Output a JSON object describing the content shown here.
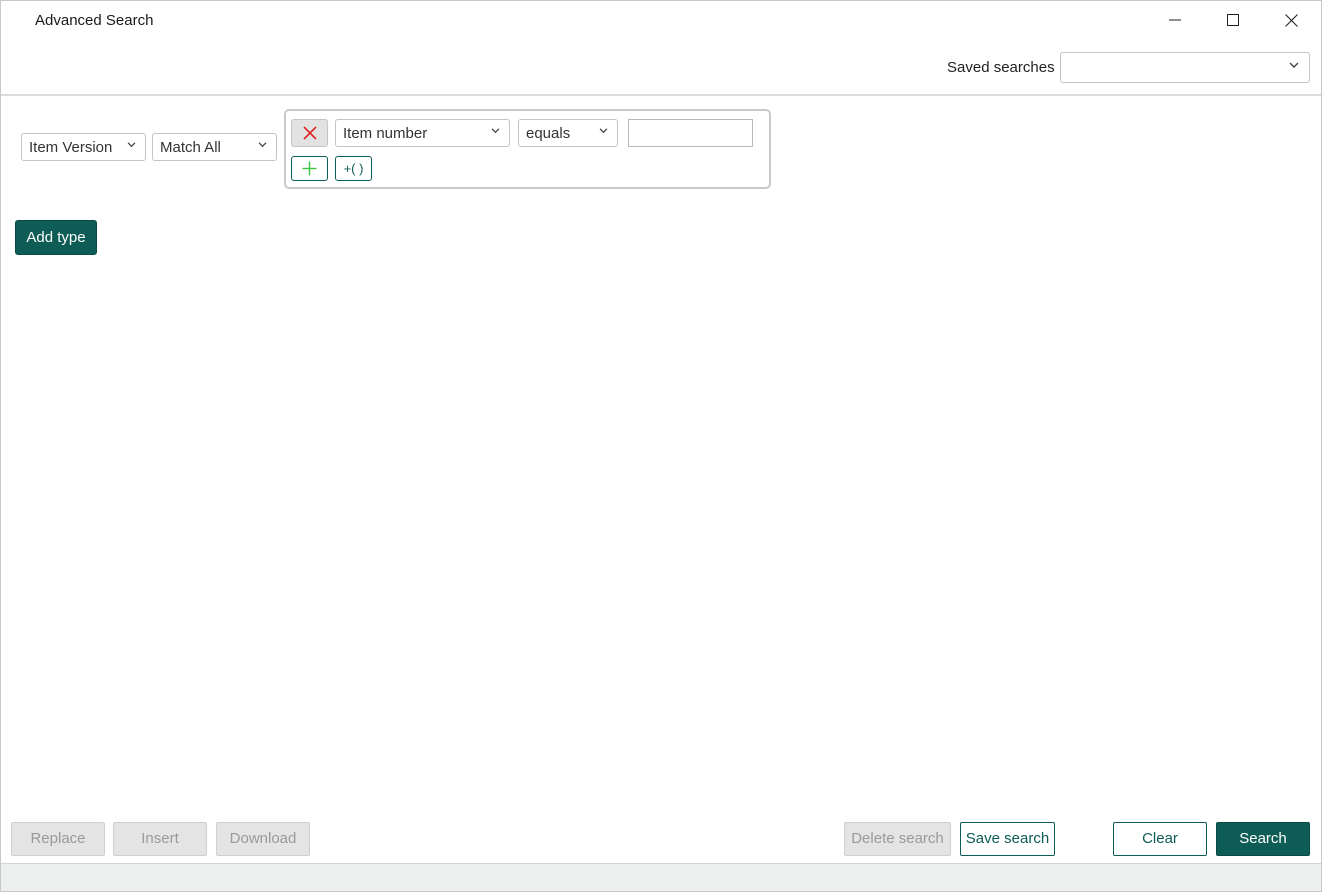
{
  "window": {
    "title": "Advanced Search"
  },
  "header": {
    "saved_searches_label": "Saved searches",
    "saved_searches_value": ""
  },
  "criteria": {
    "object_type": "Item Version",
    "match_mode": "Match All",
    "row": {
      "field": "Item number",
      "operator": "equals",
      "value": ""
    },
    "add_group_label": "+( )",
    "add_type_label": "Add type"
  },
  "footer": {
    "replace": "Replace",
    "insert": "Insert",
    "download": "Download",
    "delete_search": "Delete search",
    "save_search": "Save search",
    "clear": "Clear",
    "search": "Search"
  },
  "colors": {
    "accent": "#0e5c56",
    "remove_icon": "#e02424",
    "add_icon": "#3cc43c"
  }
}
